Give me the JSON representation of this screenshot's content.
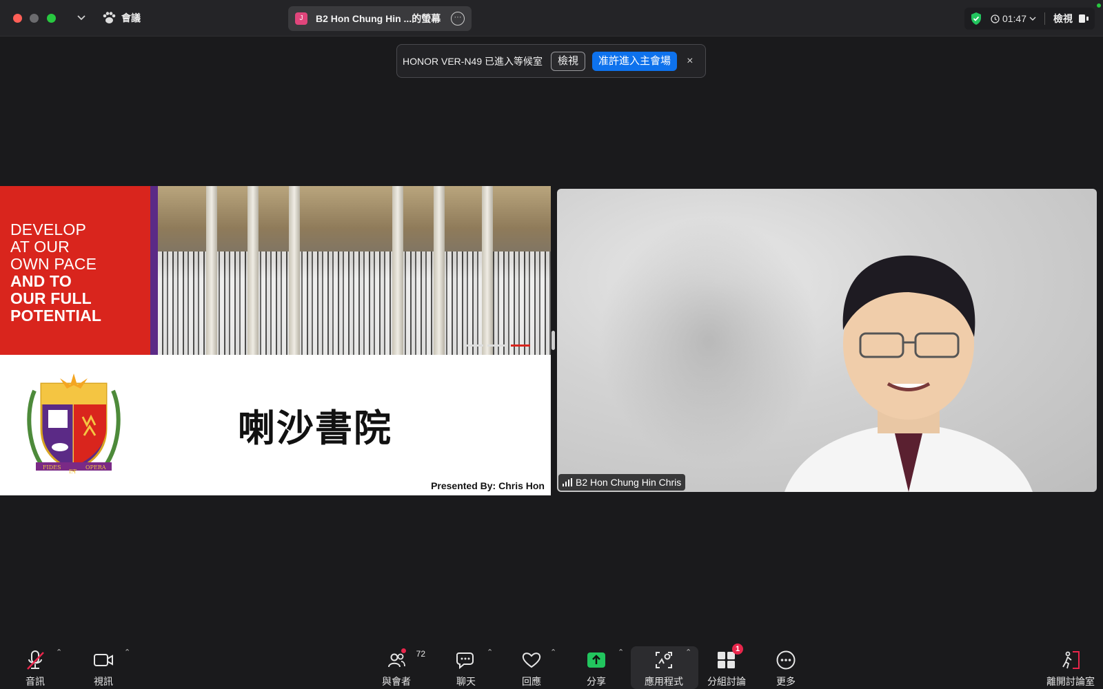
{
  "window": {
    "meeting_label": "會議",
    "share_title": "B2 Hon Chung Hin ...的螢幕",
    "share_avatar_letter": "J",
    "timer": "01:47",
    "view_label": "檢視"
  },
  "notification": {
    "text": "HONOR VER-N49 已進入等候室",
    "view_button": "檢視",
    "admit_button": "准許進入主會場",
    "close_glyph": "×"
  },
  "slide": {
    "tagline_regular": [
      "DEVELOP",
      "AT OUR",
      "OWN PACE"
    ],
    "tagline_bold": [
      "AND TO",
      "OUR FULL",
      "POTENTIAL"
    ],
    "school_name": "喇沙書院",
    "presented_by": "Presented By: Chris Hon",
    "crest_motto_left": "FIDES",
    "crest_motto_mid": "ET",
    "crest_motto_right": "OPERA",
    "colors": {
      "red": "#d9251d",
      "purple": "#5b2a86"
    }
  },
  "video": {
    "participant_name": "B2 Hon Chung Hin Chris"
  },
  "toolbar": {
    "audio": "音訊",
    "video": "視訊",
    "participants": "與會者",
    "participants_count": "72",
    "chat": "聊天",
    "reactions": "回應",
    "share": "分享",
    "apps": "應用程式",
    "breakout": "分組討論",
    "breakout_badge": "1",
    "more": "更多",
    "leave": "離開討論室"
  },
  "colors": {
    "accent_blue": "#0e72ed",
    "share_green": "#22c55e",
    "badge_red": "#e8264b"
  }
}
